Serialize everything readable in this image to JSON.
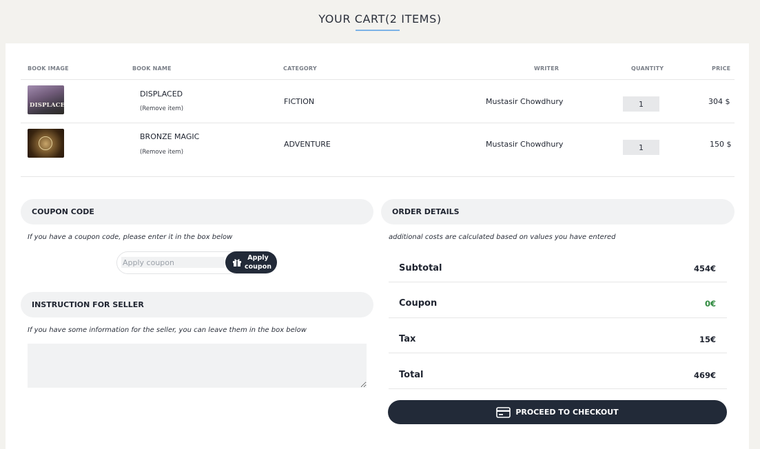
{
  "header": {
    "title": "YOUR CART(2 ITEMS)"
  },
  "table": {
    "columns": [
      "BOOK IMAGE",
      "BOOK NAME",
      "CATEGORY",
      "WRITER",
      "QUANTITY",
      "PRICE"
    ],
    "rows": [
      {
        "cover_text": "DISPLACED",
        "name": "DISPLACED",
        "remove": "(Remove item)",
        "category": "FICTION",
        "writer": "Mustasir Chowdhury",
        "quantity": "1",
        "price": "304 $"
      },
      {
        "cover_text": "",
        "name": "BRONZE MAGIC",
        "remove": "(Remove item)",
        "category": "ADVENTURE",
        "writer": "Mustasir Chowdhury",
        "quantity": "1",
        "price": "150 $"
      }
    ]
  },
  "coupon": {
    "heading": "COUPON CODE",
    "hint": "If you have a coupon code, please enter it in the box below",
    "placeholder": "Apply coupon",
    "button_line1": "Apply",
    "button_line2": "coupon"
  },
  "instructions": {
    "heading": "INSTRUCTION FOR SELLER",
    "hint": "If you have some information for the seller, you can leave them in the box below"
  },
  "order": {
    "heading": "ORDER DETAILS",
    "hint": "additional costs are calculated based on values you have entered",
    "subtotal_label": "Subtotal",
    "subtotal_value": "454€",
    "coupon_label": "Coupon",
    "coupon_value": "0€",
    "tax_label": "Tax",
    "tax_value": "15€",
    "total_label": "Total",
    "total_value": "469€",
    "checkout_label": "PROCEED TO CHECKOUT"
  },
  "colors": {
    "accent_dark": "#222a38",
    "underline": "#7cb3e6",
    "coupon_green": "#2f8a3f"
  },
  "icons": {
    "coupon_button": "gift-icon",
    "checkout_button": "credit-card-icon"
  }
}
